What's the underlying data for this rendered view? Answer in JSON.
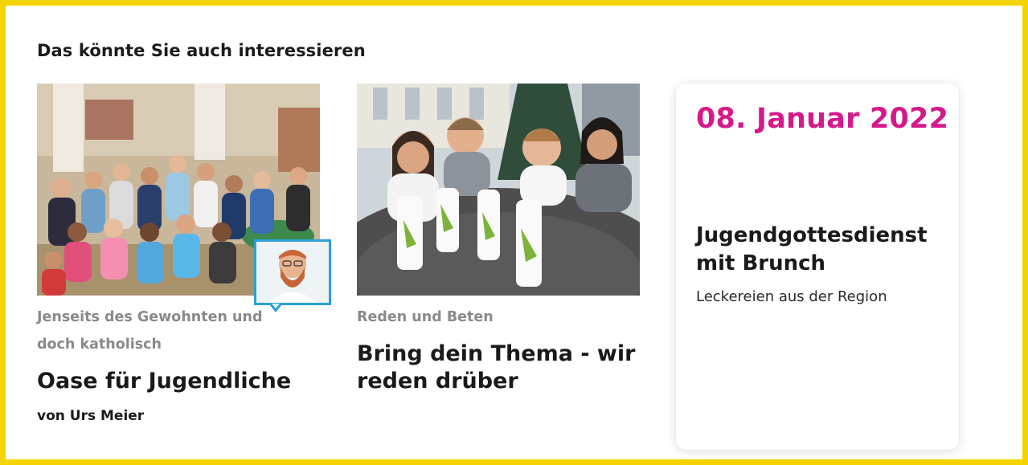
{
  "section": {
    "title": "Das könnte Sie auch interessieren"
  },
  "cards": [
    {
      "kicker": "Jenseits des Gewohnten und doch katholisch",
      "headline": "Oase für Jugendliche",
      "byline": "von Urs Meier",
      "image": "group-photo",
      "avatar": "author-avatar"
    },
    {
      "kicker": "Reden und Beten",
      "headline": "Bring dein Thema - wir reden drüber",
      "image": "candles-photo"
    }
  ],
  "event": {
    "date": "08. Januar 2022",
    "title": "Jugendgottesdienst mit Brunch",
    "subtitle": "Leckereien aus der Region"
  },
  "colors": {
    "frame": "#f4d400",
    "accent": "#d4198b",
    "avatar_border": "#2aa0d8"
  }
}
